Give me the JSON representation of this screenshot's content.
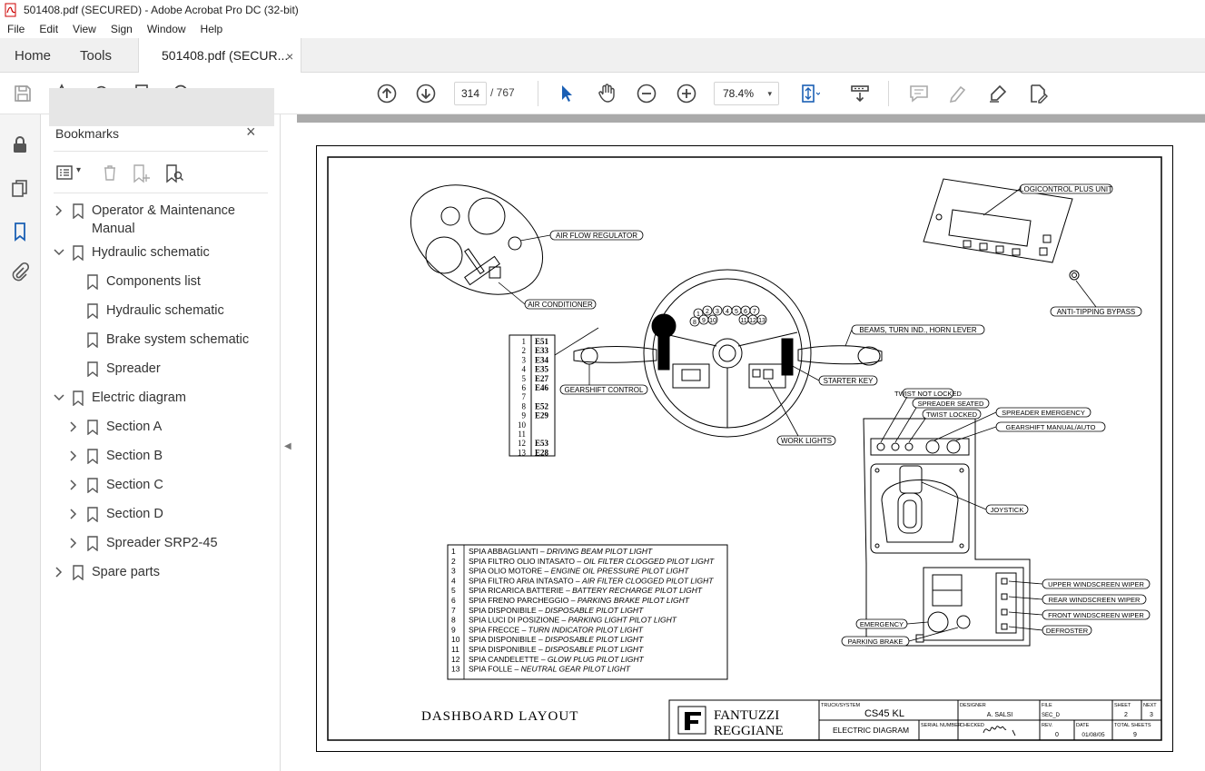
{
  "window": {
    "title": "501408.pdf (SECURED) - Adobe Acrobat Pro DC (32-bit)"
  },
  "menu": [
    "File",
    "Edit",
    "View",
    "Sign",
    "Window",
    "Help"
  ],
  "tabs": {
    "home": "Home",
    "tools": "Tools",
    "document": "501408.pdf (SECUR...",
    "close": "×"
  },
  "toolbar": {
    "page_current": "314",
    "page_total": "/ 767",
    "zoom": "78.4%",
    "caret": "▾"
  },
  "bookmarks": {
    "title": "Bookmarks",
    "close": "×",
    "items": [
      {
        "label": "Operator & Maintenance",
        "label2": "Manual",
        "level": 0,
        "expand": "collapsed",
        "selected": true
      },
      {
        "label": "Hydraulic schematic",
        "level": 0,
        "expand": "expanded"
      },
      {
        "label": "Components list",
        "level": 1,
        "expand": "none"
      },
      {
        "label": "Hydraulic schematic",
        "level": 1,
        "expand": "none"
      },
      {
        "label": "Brake system schematic",
        "level": 1,
        "expand": "none"
      },
      {
        "label": "Spreader",
        "level": 1,
        "expand": "none"
      },
      {
        "label": "Electric diagram",
        "level": 0,
        "expand": "expanded"
      },
      {
        "label": "Section A",
        "level": 1,
        "expand": "collapsed"
      },
      {
        "label": "Section B",
        "level": 1,
        "expand": "collapsed"
      },
      {
        "label": "Section C",
        "level": 1,
        "expand": "collapsed"
      },
      {
        "label": "Section D",
        "level": 1,
        "expand": "collapsed"
      },
      {
        "label": "Spreader SRP2-45",
        "level": 1,
        "expand": "collapsed"
      },
      {
        "label": "Spare parts",
        "level": 0,
        "expand": "collapsed"
      }
    ]
  },
  "drawing": {
    "labels": {
      "air_flow_regulator": "AIR FLOW REGULATOR",
      "air_conditioner": "AIR CONDITIONER",
      "logicontrol": "LOGICONTROL PLUS UNIT",
      "anti_tipping": "ANTI-TIPPING BYPASS",
      "beams": "BEAMS, TURN IND., HORN LEVER",
      "starter_key": "STARTER KEY",
      "gearshift_control": "GEARSHIFT CONTROL",
      "work_lights": "WORK LIGHTS",
      "twist_not_locked": "TWIST NOT LOCKED",
      "spreader_seated": "SPREADER SEATED",
      "twist_locked": "TWIST LOCKED",
      "spreader_emergency": "SPREADER EMERGENCY",
      "gearshift_manual": "GEARSHIFT MANUAL/AUTO",
      "joystick": "JOYSTICK",
      "upper_wiper": "UPPER WINDSCREEN WIPER",
      "rear_wiper": "REAR WINDSCREEN WIPER",
      "front_wiper": "FRONT WINDSCREEN WIPER",
      "defroster": "DEFROSTER",
      "emergency": "EMERGENCY",
      "parking_brake": "PARKING BRAKE"
    },
    "lamp_codes": [
      [
        "1",
        "E51"
      ],
      [
        "2",
        "E33"
      ],
      [
        "3",
        "E34"
      ],
      [
        "4",
        "E35"
      ],
      [
        "5",
        "E27"
      ],
      [
        "6",
        "E46"
      ],
      [
        "7",
        ""
      ],
      [
        "8",
        "E52"
      ],
      [
        "9",
        "E29"
      ],
      [
        "10",
        ""
      ],
      [
        "11",
        ""
      ],
      [
        "12",
        "E53"
      ],
      [
        "13",
        "E28"
      ]
    ],
    "wheel_numbers": [
      "1",
      "2",
      "3",
      "4",
      "5",
      "6",
      "7",
      "8",
      "9",
      "10",
      "11",
      "12",
      "13"
    ],
    "legend": [
      [
        "1",
        "SPIA ABBAGLIANTI  –",
        "DRIVING BEAM PILOT LIGHT"
      ],
      [
        "2",
        "SPIA FILTRO OLIO INTASATO  –",
        "OIL FILTER CLOGGED PILOT LIGHT"
      ],
      [
        "3",
        "SPIA OLIO MOTORE  –",
        "ENGINE OIL PRESSURE PILOT LIGHT"
      ],
      [
        "4",
        "SPIA FILTRO ARIA INTASATO  –",
        "AIR FILTER CLOGGED PILOT LIGHT"
      ],
      [
        "5",
        "SPIA RICARICA BATTERIE  –",
        "BATTERY RECHARGE PILOT LIGHT"
      ],
      [
        "6",
        "SPIA FRENO PARCHEGGIO  –",
        "PARKING BRAKE PILOT LIGHT"
      ],
      [
        "7",
        "SPIA DISPONIBILE  –",
        "DISPOSABLE PILOT LIGHT"
      ],
      [
        "8",
        "SPIA LUCI DI POSIZIONE  –",
        "PARKING LIGHT PILOT LIGHT"
      ],
      [
        "9",
        "SPIA FRECCE  –",
        "TURN INDICATOR PILOT LIGHT"
      ],
      [
        "10",
        "SPIA DISPONIBILE  –",
        "DISPOSABLE PILOT LIGHT"
      ],
      [
        "11",
        "SPIA DISPONIBILE  –",
        "DISPOSABLE PILOT LIGHT"
      ],
      [
        "12",
        "SPIA CANDELETTE  –",
        "GLOW PLUG PILOT LIGHT"
      ],
      [
        "13",
        "SPIA FOLLE  –",
        "NEUTRAL GEAR PILOT LIGHT"
      ]
    ],
    "layout_title": "DASHBOARD LAYOUT",
    "title_block": {
      "brand1": "FANTUZZI",
      "brand2": "REGGIANE",
      "truck_label": "TRUCK/SYSTEM",
      "truck": "CS45 KL",
      "designer_label": "DESIGNER",
      "designer": "A. SALSI",
      "file_label": "FILE",
      "file": "SEC_D",
      "sheet_label": "SHEET",
      "sheet": "2",
      "next_label": "NEXT",
      "next": "3",
      "doc": "ELECTRIC DIAGRAM",
      "serial_label": "SERIAL NUMBER",
      "checked_label": "CHECKED",
      "rev_label": "REV.",
      "rev": "0",
      "date_label": "DATE",
      "date": "01/08/05",
      "total_label": "TOTAL SHEETS",
      "total": "9"
    }
  }
}
